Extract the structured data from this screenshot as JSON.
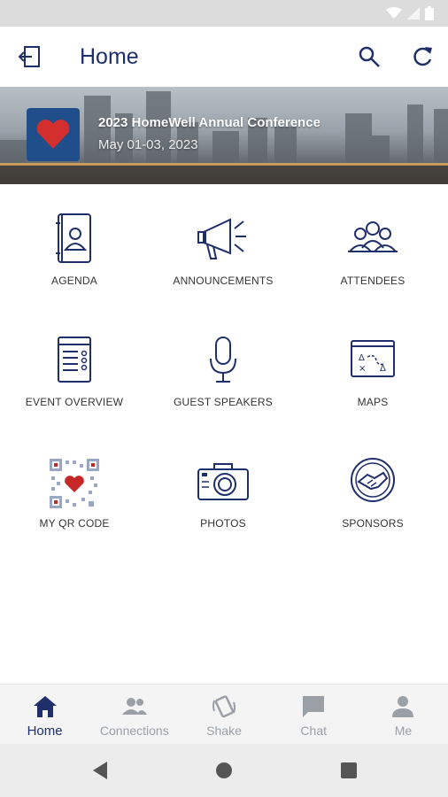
{
  "status_bar": {
    "wifi_icon": "wifi-icon",
    "signal_icon": "signal-icon",
    "battery_icon": "battery-icon"
  },
  "app_bar": {
    "title": "Home",
    "back_icon": "logout-icon",
    "search_icon": "search-icon",
    "refresh_icon": "refresh-icon"
  },
  "event": {
    "title": "2023 HomeWell Annual Conference",
    "dates": "May 01-03, 2023"
  },
  "tiles": [
    {
      "label": "AGENDA",
      "icon": "agenda-icon"
    },
    {
      "label": "ANNOUNCEMENTS",
      "icon": "megaphone-icon"
    },
    {
      "label": "ATTENDEES",
      "icon": "attendees-icon"
    },
    {
      "label": "EVENT OVERVIEW",
      "icon": "event-overview-icon"
    },
    {
      "label": "GUEST SPEAKERS",
      "icon": "microphone-icon"
    },
    {
      "label": "MAPS",
      "icon": "map-icon"
    },
    {
      "label": "MY QR CODE",
      "icon": "qr-code-icon"
    },
    {
      "label": "PHOTOS",
      "icon": "camera-icon"
    },
    {
      "label": "SPONSORS",
      "icon": "handshake-icon"
    }
  ],
  "bottom_nav": [
    {
      "label": "Home",
      "icon": "home-icon",
      "active": true
    },
    {
      "label": "Connections",
      "icon": "people-icon"
    },
    {
      "label": "Shake",
      "icon": "shake-icon"
    },
    {
      "label": "Chat",
      "icon": "chat-icon"
    },
    {
      "label": "Me",
      "icon": "person-icon"
    }
  ],
  "colors": {
    "primary": "#1e2f6b",
    "accent": "#c62828",
    "inactive": "#9aa0a6"
  }
}
